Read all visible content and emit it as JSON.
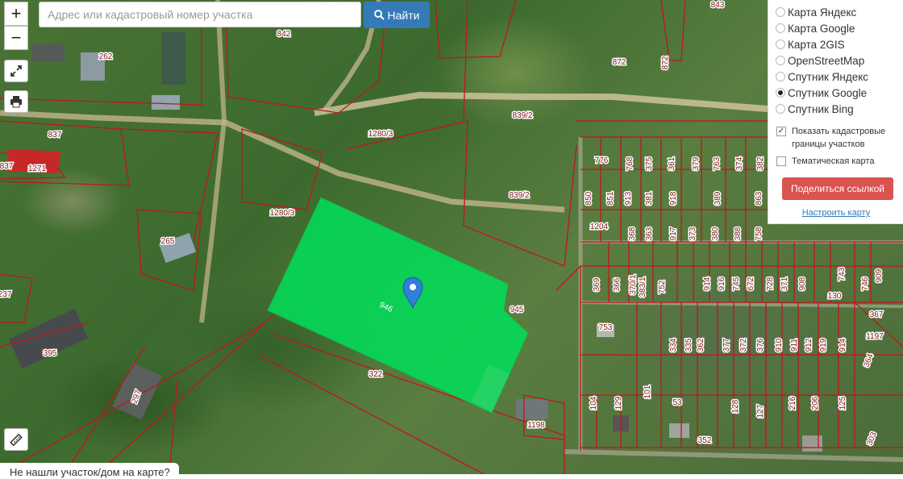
{
  "search": {
    "placeholder": "Адрес или кадастровый номер участка",
    "button_label": "Найти"
  },
  "controls": {
    "zoom_in": "+",
    "zoom_out": "−"
  },
  "layers": [
    {
      "label": "Карта Яндекс",
      "checked": false
    },
    {
      "label": "Карта Google",
      "checked": false
    },
    {
      "label": "Карта 2GIS",
      "checked": false
    },
    {
      "label": "OpenStreetMap",
      "checked": false
    },
    {
      "label": "Спутник Яндекс",
      "checked": false
    },
    {
      "label": "Спутник Google",
      "checked": true
    },
    {
      "label": "Спутник Bing",
      "checked": false
    }
  ],
  "options": {
    "cadastral_borders": {
      "label": "Показать кадастровые границы участков",
      "checked": true
    },
    "thematic_map": {
      "label": "Тематическая карта",
      "checked": false
    }
  },
  "share_button": "Поделиться ссылкой",
  "settings_link": "Настроить карту",
  "not_found_text": "Не нашли участок/дом на карте?",
  "highlight": {
    "plot_number": "946",
    "color": "#00e05a"
  },
  "colors": {
    "boundary": "#c0171a",
    "search_button": "#337ab7",
    "share_button": "#d9534f",
    "marker": "#2f7fd6"
  },
  "plot_labels": [
    "842",
    "843",
    "262",
    "872",
    "872",
    "837",
    "1271",
    "837",
    "1280/3",
    "839/2",
    "839/2",
    "1280/3",
    "265",
    "945",
    "237",
    "395",
    "322",
    "297",
    "1198",
    "776",
    "768",
    "375",
    "361",
    "379",
    "763",
    "374",
    "382",
    "850",
    "851",
    "913",
    "381",
    "918",
    "389",
    "863",
    "1204",
    "368",
    "363",
    "917",
    "373",
    "380",
    "388",
    "758",
    "369",
    "366",
    "370/1",
    "383/1",
    "752",
    "914",
    "916",
    "745",
    "672",
    "728",
    "371",
    "908",
    "743",
    "746",
    "909",
    "130",
    "753",
    "334",
    "335",
    "362",
    "377",
    "372",
    "376",
    "910",
    "911",
    "912",
    "919",
    "914",
    "367",
    "1197",
    "364",
    "104",
    "129",
    "101",
    "53",
    "128",
    "127",
    "216",
    "206",
    "125",
    "352",
    "303"
  ]
}
